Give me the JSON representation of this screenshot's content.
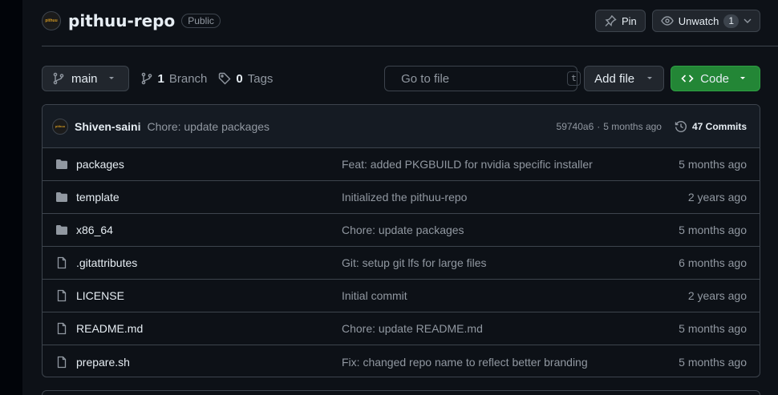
{
  "repo": {
    "owner_avatar_text": "pithuu",
    "name": "pithuu-repo",
    "visibility": "Public"
  },
  "actions": {
    "pin_label": "Pin",
    "watch_label": "Unwatch",
    "watch_count": "1"
  },
  "toolbar": {
    "branch": "main",
    "branch_count": "1",
    "branch_label": "Branch",
    "tag_count": "0",
    "tag_label": "Tags",
    "search_placeholder": "Go to file",
    "search_shortcut": "t",
    "add_file_label": "Add file",
    "code_label": "Code"
  },
  "latest_commit": {
    "author": "Shiven-saini",
    "message": "Chore: update packages",
    "hash": "59740a6",
    "separator": "·",
    "age": "5 months ago",
    "commits_label": "47 Commits"
  },
  "files": [
    {
      "type": "folder",
      "name": "packages",
      "commit": "Feat: added PKGBUILD for nvidia specific installer",
      "age": "5 months ago"
    },
    {
      "type": "folder",
      "name": "template",
      "commit": "Initialized the pithuu-repo",
      "age": "2 years ago"
    },
    {
      "type": "folder",
      "name": "x86_64",
      "commit": "Chore: update packages",
      "age": "5 months ago"
    },
    {
      "type": "file",
      "name": ".gitattributes",
      "commit": "Git: setup git lfs for large files",
      "age": "6 months ago"
    },
    {
      "type": "file",
      "name": "LICENSE",
      "commit": "Initial commit",
      "age": "2 years ago"
    },
    {
      "type": "file",
      "name": "README.md",
      "commit": "Chore: update README.md",
      "age": "5 months ago"
    },
    {
      "type": "file",
      "name": "prepare.sh",
      "commit": "Fix: changed repo name to reflect better branding",
      "age": "5 months ago"
    }
  ],
  "colors": {
    "background": "#0d1117",
    "border": "#3d444d",
    "muted_text": "#9198a1",
    "code_button": "#238636",
    "folder_icon": "#9198a1"
  }
}
